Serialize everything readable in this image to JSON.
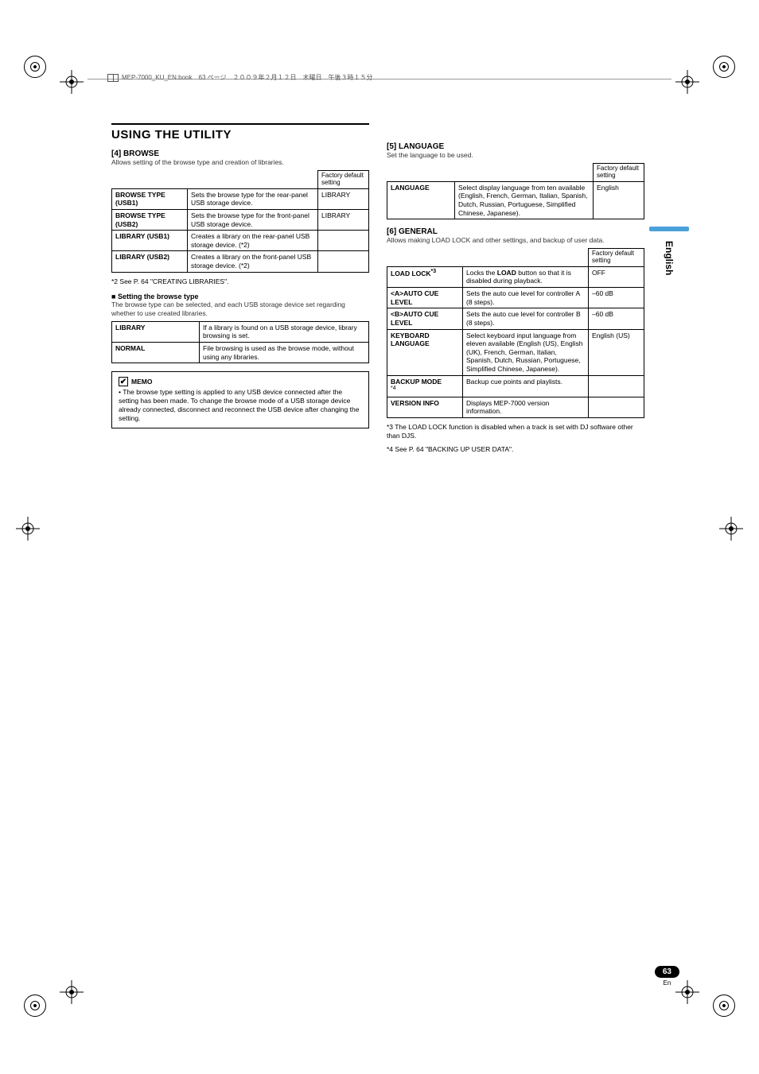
{
  "header_meta": "MEP-7000_KU_EN.book　63 ページ　２００９年２月１２日　木曜日　午後３時１５分",
  "section_bar_title": "USING THE UTILITY",
  "side_language": "English",
  "page_number": "63",
  "page_lang": "En",
  "left": {
    "browse": {
      "heading": "[4] BROWSE",
      "sub": "Allows setting of the browse type and creation of libraries.",
      "factory": "Factory default setting",
      "rows": [
        {
          "k": "BROWSE TYPE (USB1)",
          "d": "Sets the browse type for the rear-panel USB storage device.",
          "f": "LIBRARY"
        },
        {
          "k": "BROWSE TYPE (USB2)",
          "d": "Sets the browse type for the front-panel USB storage device.",
          "f": "LIBRARY"
        },
        {
          "k": "LIBRARY (USB1)",
          "d": "Creates a library on the rear-panel USB storage device. (*2)",
          "f": ""
        },
        {
          "k": "LIBRARY (USB2)",
          "d": "Creates a library on the front-panel USB storage device. (*2)",
          "f": ""
        }
      ],
      "foot2": "*2  See P. 64 \"CREATING LIBRARIES\"."
    },
    "browsetype": {
      "heading": "Setting the browse type",
      "sub": "The browse type can be selected, and each USB storage device set regarding whether to use created libraries.",
      "rows": [
        {
          "k": "LIBRARY",
          "d": "If a library is found on a USB storage device, library browsing is set."
        },
        {
          "k": "NORMAL",
          "d": "File browsing is used as the browse mode, without using any libraries."
        }
      ]
    },
    "memo": {
      "title": "MEMO",
      "item": "The browse type setting is applied to any USB device connected after the setting has been made. To change the browse mode of a USB storage device already connected, disconnect and reconnect the USB device after changing the setting."
    }
  },
  "right": {
    "language": {
      "heading": "[5] LANGUAGE",
      "sub": "Set the language to be used.",
      "factory": "Factory default setting",
      "rows": [
        {
          "k": "LANGUAGE",
          "d": "Select display language from ten available (English, French, German, Italian, Spanish, Dutch, Russian, Portuguese, Simplified Chinese, Japanese).",
          "f": "English"
        }
      ]
    },
    "general": {
      "heading": "[6] GENERAL",
      "sub": "Allows making LOAD LOCK and other settings, and backup of user data.",
      "factory": "Factory default setting",
      "rows": [
        {
          "k": "LOAD LOCK",
          "sup": "*3",
          "d_pre": "Locks the ",
          "d_bold": "LOAD",
          "d_post": " button so that it is disabled during playback.",
          "f": "OFF"
        },
        {
          "k": "<A>AUTO CUE LEVEL",
          "d": "Sets the auto cue level for controller A (8 steps).",
          "f": "–60 dB"
        },
        {
          "k": "<B>AUTO CUE LEVEL",
          "d": "Sets the auto cue level for controller B (8 steps).",
          "f": "–60 dB"
        },
        {
          "k": "KEYBOARD LANGUAGE",
          "d": "Select keyboard input language from eleven available (English (US), English (UK), French, German, Italian, Spanish, Dutch, Russian, Portuguese, Simplified Chinese, Japanese).",
          "f": "English (US)"
        },
        {
          "k": "BACKUP MODE",
          "sup": "*4",
          "d": "Backup cue points and playlists.",
          "f": ""
        },
        {
          "k": "VERSION INFO",
          "d": "Displays MEP-7000 version information.",
          "f": ""
        }
      ],
      "foot3": "*3  The LOAD LOCK function is disabled when a track is set with DJ software other than DJS.",
      "foot4": "*4  See P. 64 \"BACKING UP USER DATA\"."
    }
  }
}
